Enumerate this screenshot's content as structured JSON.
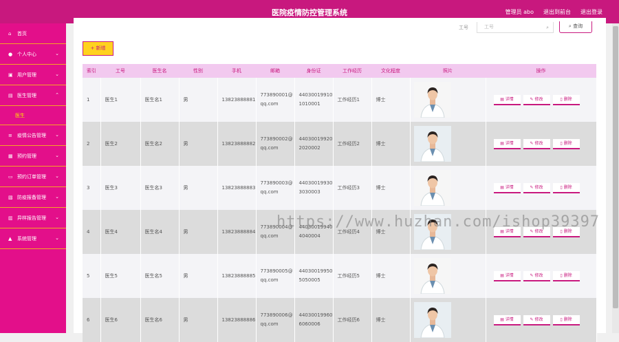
{
  "header": {
    "title": "医院疫情防控管理系统",
    "admin": "管理员 abo",
    "exit_to_frontend": "退出到前台",
    "logout": "退出登录"
  },
  "sidebar": {
    "items": [
      {
        "label": "首页",
        "icon": "home-icon",
        "chevron": false
      },
      {
        "label": "个人中心",
        "icon": "user-icon",
        "chevron": true
      },
      {
        "label": "用户管理",
        "icon": "users-icon",
        "chevron": true
      },
      {
        "label": "医生管理",
        "icon": "doctor-icon",
        "chevron": true,
        "open": true
      },
      {
        "label": "疫情公告管理",
        "icon": "notice-icon",
        "chevron": true
      },
      {
        "label": "预约管理",
        "icon": "calendar-icon",
        "chevron": true
      },
      {
        "label": "预约订单管理",
        "icon": "order-icon",
        "chevron": true
      },
      {
        "label": "防疫报备管理",
        "icon": "report-icon",
        "chevron": true
      },
      {
        "label": "异样报告管理",
        "icon": "alert-icon",
        "chevron": true
      },
      {
        "label": "系统管理",
        "icon": "settings-icon",
        "chevron": true
      }
    ],
    "sub_item": "医生"
  },
  "search": {
    "label": "工号",
    "placeholder": "工号",
    "button": "查询"
  },
  "toolbar": {
    "add": "+ 新增"
  },
  "table": {
    "columns": [
      "索引",
      "工号",
      "医生名",
      "性别",
      "手机",
      "邮箱",
      "身份证",
      "工作经历",
      "文化程度",
      "照片",
      "操作"
    ],
    "rows": [
      {
        "index": "1",
        "id": "医生1",
        "name": "医生名1",
        "gender": "男",
        "phone": "13823888881",
        "email": "773890001@qq.com",
        "idcard": "440300199101010001",
        "experience": "工作经历1",
        "education": "博士"
      },
      {
        "index": "2",
        "id": "医生2",
        "name": "医生名2",
        "gender": "男",
        "phone": "13823888882",
        "email": "773890002@qq.com",
        "idcard": "440300199202020002",
        "experience": "工作经历2",
        "education": "博士"
      },
      {
        "index": "3",
        "id": "医生3",
        "name": "医生名3",
        "gender": "男",
        "phone": "13823888883",
        "email": "773890003@qq.com",
        "idcard": "440300199303030003",
        "experience": "工作经历3",
        "education": "博士"
      },
      {
        "index": "4",
        "id": "医生4",
        "name": "医生名4",
        "gender": "男",
        "phone": "13823888884",
        "email": "773890004@qq.com",
        "idcard": "440300199404040004",
        "experience": "工作经历4",
        "education": "博士"
      },
      {
        "index": "5",
        "id": "医生5",
        "name": "医生名5",
        "gender": "男",
        "phone": "13823888885",
        "email": "773890005@qq.com",
        "idcard": "440300199505050005",
        "experience": "工作经历5",
        "education": "博士"
      },
      {
        "index": "6",
        "id": "医生6",
        "name": "医生名6",
        "gender": "男",
        "phone": "13823888886",
        "email": "773890006@qq.com",
        "idcard": "440300199606060006",
        "experience": "工作经历6",
        "education": "博士"
      }
    ],
    "actions": {
      "detail": "详情",
      "edit": "修改",
      "delete": "删除"
    }
  },
  "watermark": "https://www.huzhan.com/ishop39397",
  "colors": {
    "primary": "#c8187e",
    "sidebar": "#e30f8a",
    "accent": "#ffd21e",
    "header_row": "#f2c9ef"
  }
}
